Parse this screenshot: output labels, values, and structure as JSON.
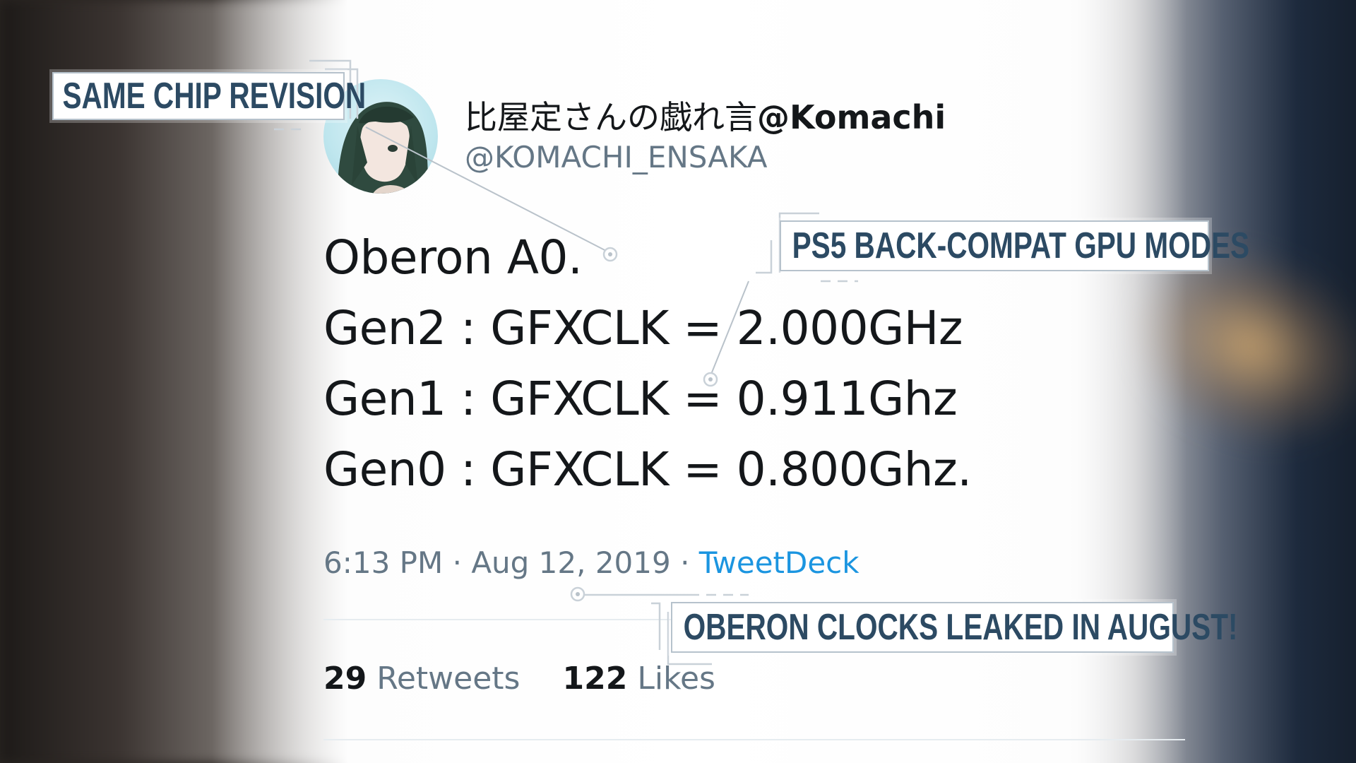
{
  "tweet": {
    "display_name_cjk": "比屋定さんの戯れ言",
    "display_name_latin": "@Komachi",
    "handle": "@KOMACHI_ENSAKA",
    "lines": [
      "Oberon A0.",
      "Gen2 : GFXCLK = 2.000GHz",
      "Gen1 : GFXCLK = 0.911Ghz",
      "Gen0 : GFXCLK = 0.800Ghz."
    ],
    "time": "6:13 PM",
    "date": "Aug 12, 2019",
    "separator": "·",
    "source": "TweetDeck",
    "retweets_count": "29",
    "retweets_label": "Retweets",
    "likes_count": "122",
    "likes_label": "Likes"
  },
  "callouts": {
    "chip_revision": "SAME CHIP REVISION",
    "gpu_modes": "PS5 BACK-COMPAT GPU MODES",
    "leak_date": "OBERON CLOCKS LEAKED IN AUGUST!"
  },
  "colors": {
    "callout_text": "#2c4a63",
    "link": "#1b95e0",
    "muted": "#657786",
    "text": "#14171a"
  }
}
